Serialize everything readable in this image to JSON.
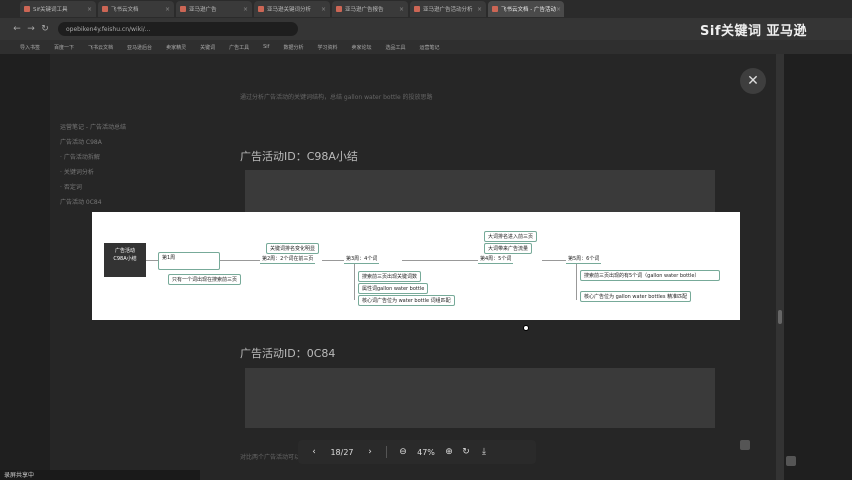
{
  "browser": {
    "tabs": [
      {
        "label": "Sif关键词工具",
        "active": false
      },
      {
        "label": "飞书云文档",
        "active": false
      },
      {
        "label": "亚马逊广告",
        "active": false
      },
      {
        "label": "亚马逊关键词分析",
        "active": false
      },
      {
        "label": "亚马逊广告报告",
        "active": false
      },
      {
        "label": "亚马逊广告活动分析",
        "active": false
      },
      {
        "label": "飞书云文档 - 广告活动",
        "active": true
      }
    ],
    "url": "opebiken4y.feishu.cn/wiki/...",
    "back": "←",
    "forward": "→",
    "refresh": "↻",
    "bookmarks": [
      "导入书签",
      "百度一下",
      "飞书云文档",
      "亚马逊后台",
      "卖家精灵",
      "关键词",
      "广告工具",
      "Sif",
      "数据分析",
      "学习资料",
      "卖家论坛",
      "选品工具",
      "运营笔记"
    ]
  },
  "watermark": "Sif关键词 亚马逊",
  "doc": {
    "sidebar": [
      "运营笔记 - 广告活动总结",
      "广告活动 C98A",
      "· 广告活动拆解",
      "· 关键词分析",
      "· 否定词",
      "广告活动 0C84"
    ],
    "intro_line": "通过分析广告活动的关键词结构，总结 gallon water bottle 的投放思路",
    "heading1": "广告活动ID：C98A小结",
    "heading2": "广告活动ID：0C84",
    "outro_line": "对比两个广告活动可以发现，关键词的选择和否定策略决定了广告的效果。"
  },
  "viewer": {
    "close": "✕",
    "mindmap": {
      "root": "广告活动\nC98A小结",
      "n1": "第1周",
      "n1_sub": "只有一个词出现在搜索前三页",
      "n2": "第2周：2个词在前三页",
      "n2_up": "关键词排名变化明显",
      "n3": "第3周：4个词",
      "n3_a": "搜索前三页出现关键词数",
      "n3_b": "属性词gallon water bottle",
      "n3_c": "核心词广告位为 water bottle 词组匹配",
      "n4": "第4周：5个词",
      "n4_up1": "大词排名进入前三页",
      "n4_up2": "大词带来广告流量",
      "n5": "第5周：6个词",
      "n5_a": "搜索前三页出现的有5个词（gallon water bottle）",
      "n5_b": "核心广告位为 gallon water bottles 精准匹配"
    }
  },
  "toolbar": {
    "prev": "‹",
    "page": "18/27",
    "next": "›",
    "zoom_out": "⊖",
    "zoom": "47%",
    "zoom_in": "⊕",
    "rotate": "↻",
    "download": "⤓"
  },
  "status": "录屏共享中"
}
